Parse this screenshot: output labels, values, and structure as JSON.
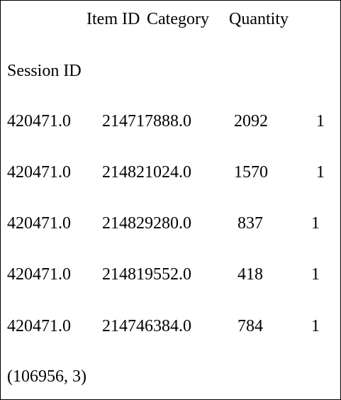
{
  "header": {
    "columns": [
      "Item ID",
      "Category",
      "Quantity"
    ],
    "index_name": "Session ID"
  },
  "rows": [
    {
      "session_id": "420471.0",
      "item_id": "214717888.0",
      "category": "2092",
      "quantity": "1"
    },
    {
      "session_id": "420471.0",
      "item_id": "214821024.0",
      "category": "1570",
      "quantity": "1"
    },
    {
      "session_id": "420471.0",
      "item_id": "214829280.0",
      "category": "837",
      "quantity": "1"
    },
    {
      "session_id": "420471.0",
      "item_id": "214819552.0",
      "category": "418",
      "quantity": "1"
    },
    {
      "session_id": "420471.0",
      "item_id": "214746384.0",
      "category": "784",
      "quantity": "1"
    }
  ],
  "shape_text": "(106956, 3)"
}
